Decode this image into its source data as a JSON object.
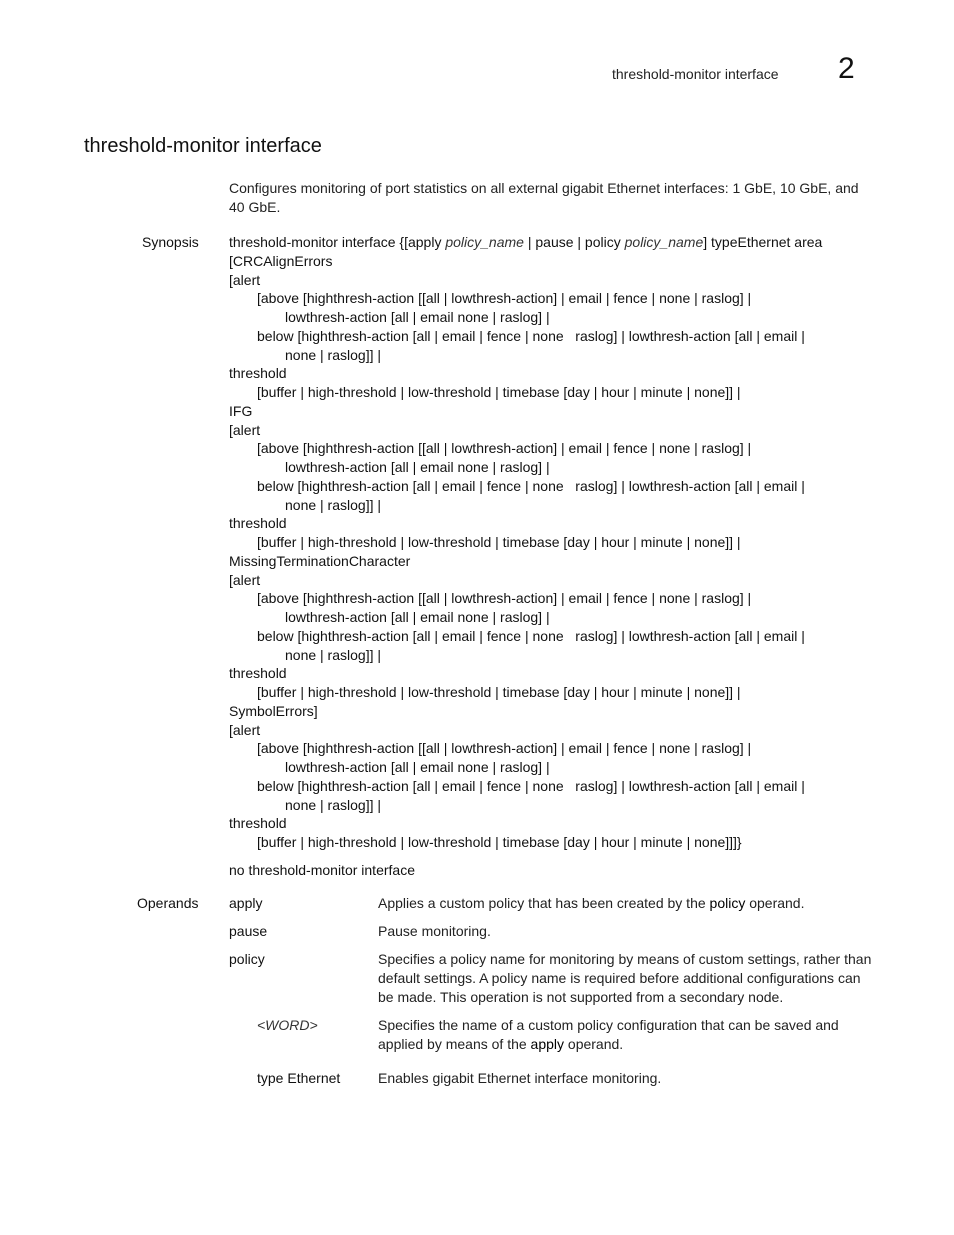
{
  "header": {
    "running_title": "threshold-monitor interface",
    "chapter_number": "2"
  },
  "title": "threshold-monitor interface",
  "intro": "Configures monitoring of port statistics on all external gigabit Ethernet interfaces: 1 GbE, 10 GbE, and 40 GbE.",
  "synopsis": {
    "label": "Synopsis",
    "line0_pre": "threshold-monitor interface {[apply ",
    "line0_arg1": "policy_name",
    "line0_mid": " | pause | policy ",
    "line0_arg2": "policy_name",
    "line0_post": "] typeEthernet area",
    "lines": [
      {
        "indent": 0,
        "text": "[CRCAlignErrors"
      },
      {
        "indent": 0,
        "text": "[alert"
      },
      {
        "indent": 1,
        "text": "[above [highthresh-action [[all | lowthresh-action] | email | fence | none | raslog] |"
      },
      {
        "indent": 2,
        "text": "lowthresh-action [all | email none | raslog] |"
      },
      {
        "indent": 1,
        "text": "below [highthresh-action [all | email | fence | none   raslog] | lowthresh-action [all | email |"
      },
      {
        "indent": 2,
        "text": "none | raslog]] |"
      },
      {
        "indent": 0,
        "text": "threshold"
      },
      {
        "indent": 1,
        "text": "[buffer | high-threshold | low-threshold | timebase [day | hour | minute | none]] |"
      },
      {
        "indent": 0,
        "text": "IFG"
      },
      {
        "indent": 0,
        "text": "[alert"
      },
      {
        "indent": 1,
        "text": "[above [highthresh-action [[all | lowthresh-action] | email | fence | none | raslog] |"
      },
      {
        "indent": 2,
        "text": "lowthresh-action [all | email none | raslog] |"
      },
      {
        "indent": 1,
        "text": "below [highthresh-action [all | email | fence | none   raslog] | lowthresh-action [all | email |"
      },
      {
        "indent": 2,
        "text": "none | raslog]] |"
      },
      {
        "indent": 0,
        "text": "threshold"
      },
      {
        "indent": 1,
        "text": "[buffer | high-threshold | low-threshold | timebase [day | hour | minute | none]] |"
      },
      {
        "indent": 0,
        "text": "MissingTerminationCharacter"
      },
      {
        "indent": 0,
        "text": "[alert"
      },
      {
        "indent": 1,
        "text": "[above [highthresh-action [[all | lowthresh-action] | email | fence | none | raslog] |"
      },
      {
        "indent": 2,
        "text": "lowthresh-action [all | email none | raslog] |"
      },
      {
        "indent": 1,
        "text": "below [highthresh-action [all | email | fence | none   raslog] | lowthresh-action [all | email |"
      },
      {
        "indent": 2,
        "text": "none | raslog]] |"
      },
      {
        "indent": 0,
        "text": "threshold"
      },
      {
        "indent": 1,
        "text": "[buffer | high-threshold | low-threshold | timebase [day | hour | minute | none]] |"
      },
      {
        "indent": 0,
        "text": "SymbolErrors]"
      },
      {
        "indent": 0,
        "text": "[alert"
      },
      {
        "indent": 1,
        "text": "[above [highthresh-action [[all | lowthresh-action] | email | fence | none | raslog] |"
      },
      {
        "indent": 2,
        "text": "lowthresh-action [all | email none | raslog] |"
      },
      {
        "indent": 1,
        "text": "below [highthresh-action [all | email | fence | none   raslog] | lowthresh-action [all | email |"
      },
      {
        "indent": 2,
        "text": "none | raslog]] |"
      },
      {
        "indent": 0,
        "text": "threshold"
      },
      {
        "indent": 1,
        "text": "[buffer | high-threshold | low-threshold | timebase [day | hour | minute | none]]]}"
      }
    ],
    "no_form": "no threshold-monitor interface"
  },
  "operands": {
    "label": "Operands",
    "items": [
      {
        "term": "apply",
        "desc_pre": "Applies a custom policy that has been created by the ",
        "desc_kw": "policy",
        "desc_post": " operand."
      },
      {
        "term": "pause",
        "desc": "Pause monitoring."
      },
      {
        "term": "policy",
        "desc": "Specifies a policy name for monitoring by means of custom settings, rather than default settings. A policy name is required before additional configurations can be made. This operation is not supported from a secondary node."
      },
      {
        "term": "<WORD>",
        "desc_pre": "Specifies the name of a custom policy configuration that can be saved and applied by means of the ",
        "desc_kw": "apply",
        "desc_post": " operand."
      },
      {
        "term": "type Ethernet",
        "desc": "Enables gigabit Ethernet interface monitoring."
      }
    ]
  }
}
